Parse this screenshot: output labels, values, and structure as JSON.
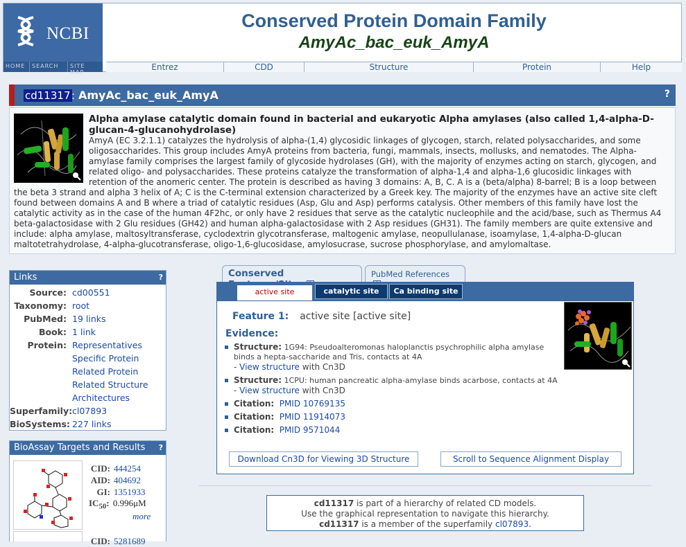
{
  "header": {
    "logo_text": "NCBI",
    "logo_links": [
      "HOME",
      "SEARCH",
      "SITE MAP"
    ],
    "title": "Conserved Protein Domain Family",
    "subtitle": "AmyAc_bac_euk_AmyA",
    "nav": [
      "Entrez",
      "CDD",
      "Structure",
      "Protein",
      "Help"
    ]
  },
  "cd_bar": {
    "accession": "cd11317",
    "separator": ":",
    "name": "AmyAc_bac_euk_AmyA",
    "help": "?"
  },
  "description": {
    "heading": "Alpha amylase catalytic domain found in bacterial and eukaryotic Alpha amylases (also called 1,4-alpha-D-glucan-4-glucanohydrolase)",
    "body": "AmyA (EC 3.2.1.1) catalyzes the hydrolysis of alpha-(1,4) glycosidic linkages of glycogen, starch, related polysaccharides, and some oligosaccharides. This group includes AmyA proteins from bacteria, fungi, mammals, insects, mollusks, and nematodes. The Alpha-amylase family comprises the largest family of glycoside hydrolases (GH), with the majority of enzymes acting on starch, glycogen, and related oligo- and polysaccharides. These proteins catalyze the transformation of alpha-1,4 and alpha-1,6 glucosidic linkages with retention of the anomeric center. The protein is described as having 3 domains: A, B, C. A is a (beta/alpha) 8-barrel; B is a loop between the beta 3 strand and alpha 3 helix of A; C is the C-terminal extension characterized by a Greek key. The majority of the enzymes have an active site cleft found between domains A and B where a triad of catalytic residues (Asp, Glu and Asp) performs catalysis. Other members of this family have lost the catalytic activity as in the case of the human 4F2hc, or only have 2 residues that serve as the catalytic nucleophile and the acid/base, such as Thermus A4 beta-galactosidase with 2 Glu residues (GH42) and human alpha-galactosidase with 2 Asp residues (GH31). The family members are quite extensive and include: alpha amylase, maltosyltransferase, cyclodextrin glycotransferase, maltogenic amylase, neopullulanase, isoamylase, 1,4-alpha-D-glucan maltotetrahydrolase, 4-alpha-glucotransferase, oligo-1,6-glucosidase, amylosucrase, sucrose phosphorylase, and amylomaltase."
  },
  "links_panel": {
    "title": "Links",
    "help": "?",
    "rows": [
      {
        "label": "Source:",
        "value": "cd00551"
      },
      {
        "label": "Taxonomy:",
        "value": "root"
      },
      {
        "label": "PubMed:",
        "value": "19 links"
      },
      {
        "label": "Book:",
        "value": "1 link"
      },
      {
        "label": "Protein:",
        "value": "Representatives"
      },
      {
        "label": "",
        "value": "Specific Protein"
      },
      {
        "label": "",
        "value": "Related Protein"
      },
      {
        "label": "",
        "value": "Related Structure"
      },
      {
        "label": "",
        "value": "Architectures"
      },
      {
        "label": "Superfamily:",
        "value": "cl07893"
      },
      {
        "label": "BioSystems:",
        "value": "227 links"
      }
    ]
  },
  "bioassay_panel": {
    "title": "BioAssay Targets and Results",
    "help": "?",
    "cid_label": "CID:",
    "cid": "444254",
    "aid_label": "AID:",
    "aid": "404692",
    "gi_label": "GI:",
    "gi": "1351933",
    "ic50_label": "IC",
    "ic50_sub": "50",
    "ic50_colon": ":",
    "ic50": "0.996μM",
    "more": "more",
    "cid2": "5281689"
  },
  "features": {
    "tabs": [
      {
        "label": "Conserved Features/Sites",
        "help": "?"
      },
      {
        "label": "PubMed References",
        "help": "?"
      }
    ],
    "sub_tabs": [
      "active site",
      "catalytic site",
      "Ca binding site"
    ],
    "feature_label": "Feature 1:",
    "feature_text": "active site [active site]",
    "evidence_label": "Evidence:",
    "evidence": [
      {
        "label": "Structure:",
        "text": "1G94: Pseudoalteromonas haloplanctis psychrophilic alpha amylase binds a hepta-saccharide and Tris, contacts at 4A",
        "link": "View structure",
        "suffix": " with Cn3D"
      },
      {
        "label": "Structure:",
        "text": "1CPU: human pancreatic alpha-amylase binds acarbose, contacts at 4A",
        "link": "View structure",
        "suffix": " with Cn3D"
      },
      {
        "label": "Citation:",
        "link": "PMID 10769135"
      },
      {
        "label": "Citation:",
        "link": "PMID 11914073"
      },
      {
        "label": "Citation:",
        "link": "PMID 9571044"
      }
    ],
    "download_button": "Download Cn3D for Viewing 3D Structure",
    "scroll_button": "Scroll to Sequence Alignment Display"
  },
  "hierarchy": {
    "acc": "cd11317",
    "line1_suffix": " is part of a hierarchy of related CD models.",
    "line2": "Use the graphical representation to navigate this hierarchy.",
    "line3_suffix": " is a member of the superfamily ",
    "superfamily": "cl07893",
    "period": "."
  },
  "colors": {
    "header_blue": "#3d69a4",
    "title_blue": "#2f5f95",
    "subtitle_green": "#174415",
    "accent_red": "#b61e1e",
    "link_blue": "#1a4aa8"
  }
}
